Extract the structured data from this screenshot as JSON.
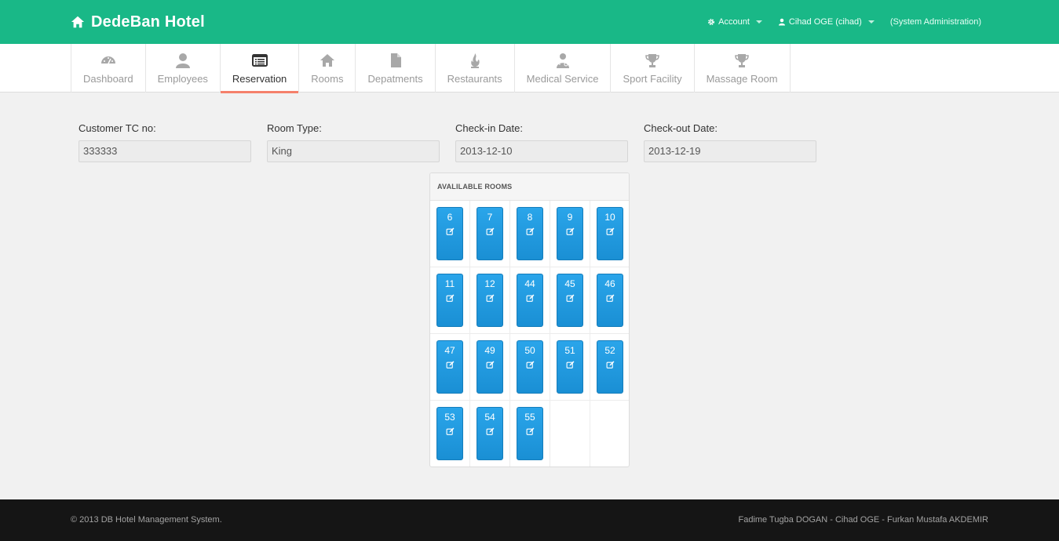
{
  "app": {
    "title": "DedeBan Hotel",
    "accent": "#19b887",
    "icon": "home-icon"
  },
  "topnav": {
    "account": "Account",
    "user": "Cihad OGE (cihad)",
    "role": "(System Administration)"
  },
  "tabs": [
    {
      "label": "Dashboard",
      "icon": "dashboard-icon"
    },
    {
      "label": "Employees",
      "icon": "user-icon"
    },
    {
      "label": "Reservation",
      "icon": "list-icon",
      "active": true
    },
    {
      "label": "Rooms",
      "icon": "home-icon"
    },
    {
      "label": "Depatments",
      "icon": "file-icon"
    },
    {
      "label": "Restaurants",
      "icon": "fire-icon"
    },
    {
      "label": "Medical Service",
      "icon": "doctor-icon"
    },
    {
      "label": "Sport Facility",
      "icon": "trophy-icon"
    },
    {
      "label": "Massage Room",
      "icon": "trophy-icon"
    }
  ],
  "form": {
    "customer_tc": {
      "label": "Customer TC no:",
      "value": "333333"
    },
    "room_type": {
      "label": "Room Type:",
      "value": "King"
    },
    "check_in": {
      "label": "Check-in Date:",
      "value": "2013-12-10"
    },
    "check_out": {
      "label": "Check-out Date:",
      "value": "2013-12-19"
    }
  },
  "rooms_panel": {
    "title": "AVALILABLE ROOMS",
    "rooms": [
      "6",
      "7",
      "8",
      "9",
      "10",
      "11",
      "12",
      "44",
      "45",
      "46",
      "47",
      "49",
      "50",
      "51",
      "52",
      "53",
      "54",
      "55"
    ],
    "button_color": "#1f9ae0"
  },
  "footer": {
    "copyright": "© 2013 DB Hotel Management System.",
    "authors": "Fadime Tugba DOGAN - Cihad OGE - Furkan Mustafa AKDEMIR"
  }
}
